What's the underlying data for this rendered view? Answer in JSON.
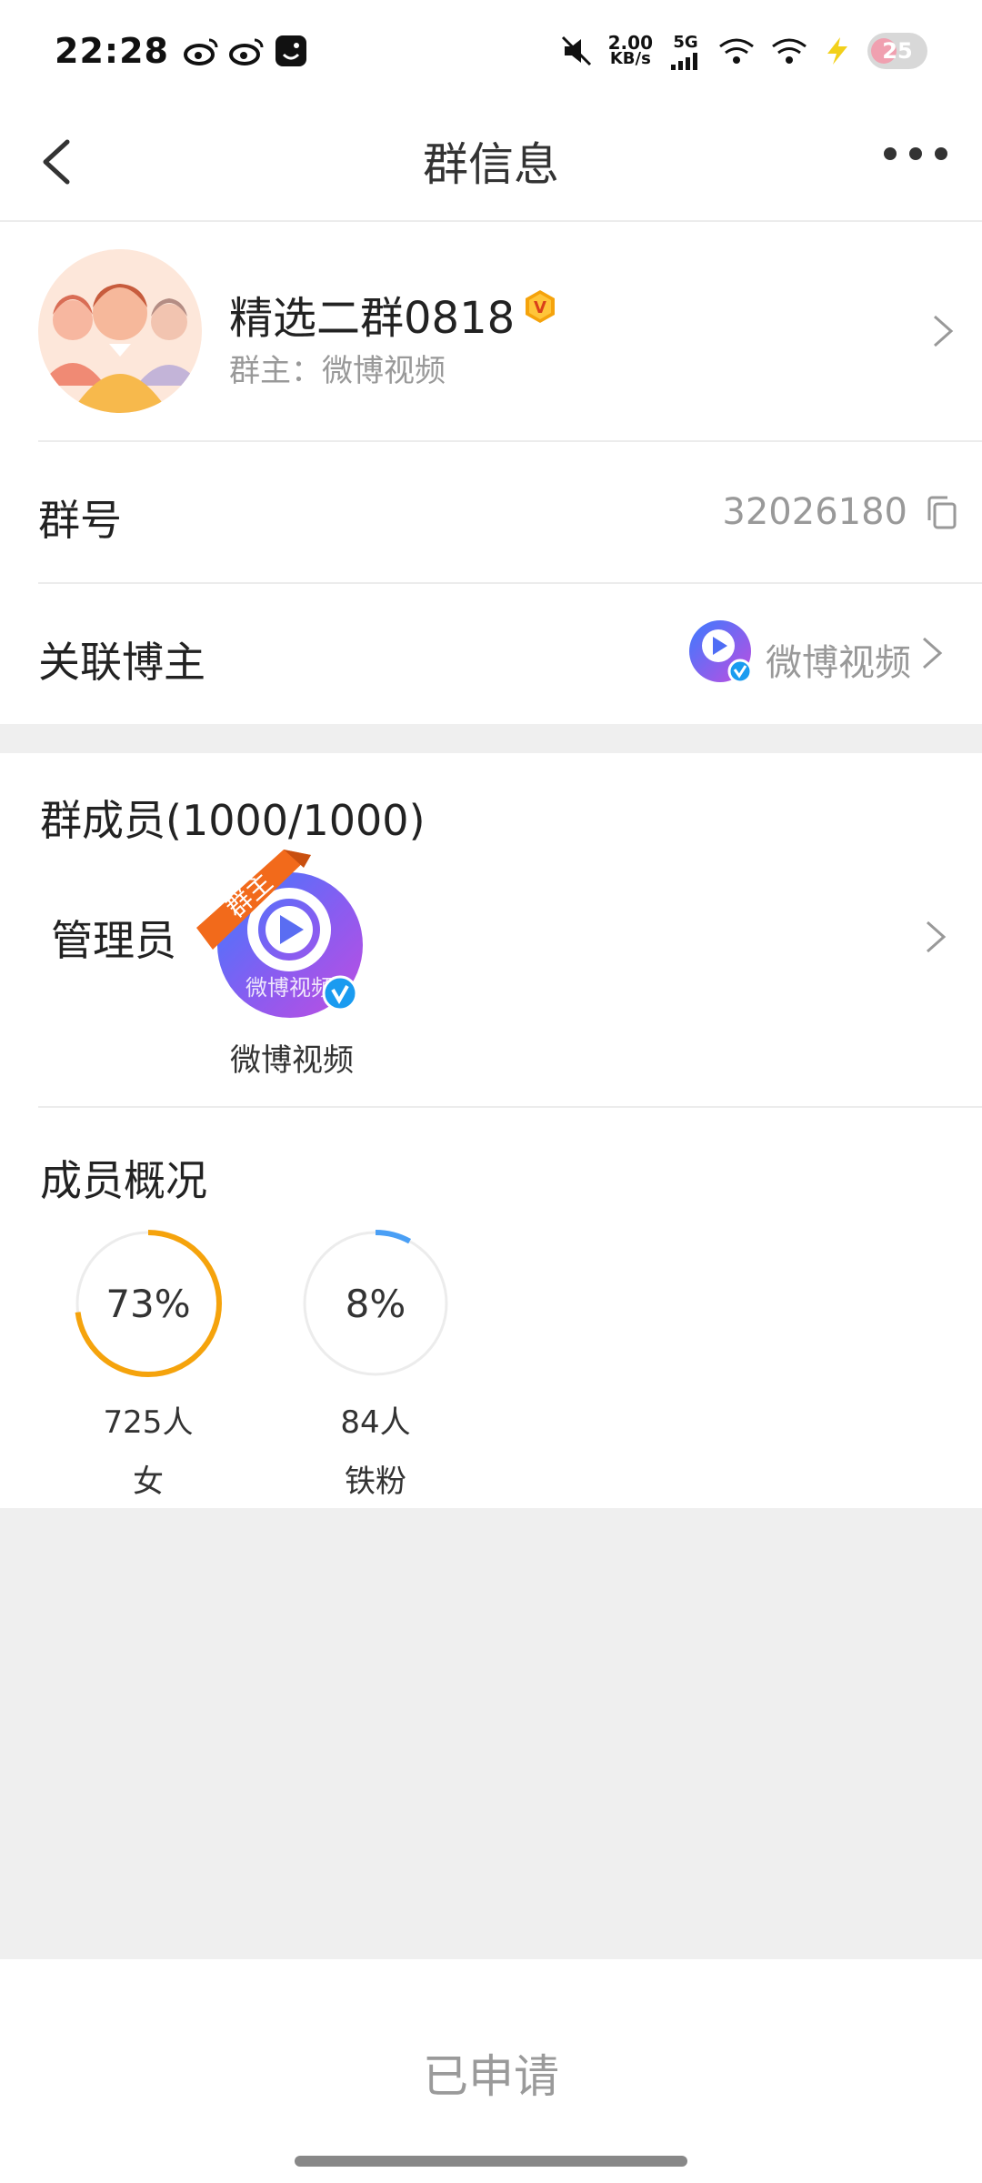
{
  "status_bar": {
    "time": "22:28",
    "net_speed_value": "2.00",
    "net_speed_unit": "KB/s",
    "network": "5G",
    "battery": "25",
    "icons": [
      "weibo-icon",
      "weibo-icon",
      "notification-app-icon",
      "mute-icon",
      "signal-icon",
      "wifi-icon",
      "wifi-icon",
      "charging-icon",
      "battery-icon"
    ]
  },
  "nav": {
    "title": "群信息",
    "icons": [
      "back-arrow-icon",
      "more-icon"
    ]
  },
  "group": {
    "name": "精选二群0818",
    "owner": "群主：微博视频",
    "number_label": "群号",
    "number_value": "32026180",
    "blogger_label": "关联博主",
    "blogger_name": "微博视频",
    "icons": [
      "group-avatar-icon",
      "vip-badge-icon",
      "copy-icon",
      "chevron-right-icon"
    ]
  },
  "members": {
    "title": "群成员(1000/1000)",
    "admin_label": "管理员",
    "admin_name": "微博视频",
    "owner_tag": "群主",
    "avatar_text": "微博视频"
  },
  "overview": {
    "title": "成员概况",
    "stats": [
      {
        "pct_text": "73%",
        "pct": 0.73,
        "count": "725人",
        "label": "女",
        "color": "#f5a30c"
      },
      {
        "pct_text": "8%",
        "pct": 0.08,
        "count": "84人",
        "label": "铁粉",
        "color": "#4a9ff5"
      }
    ]
  },
  "bottom": {
    "apply_label": "已申请"
  },
  "colors": {
    "accent_orange": "#f5a30c",
    "accent_blue": "#4a9ff5",
    "ribbon": "#f26a1b"
  }
}
